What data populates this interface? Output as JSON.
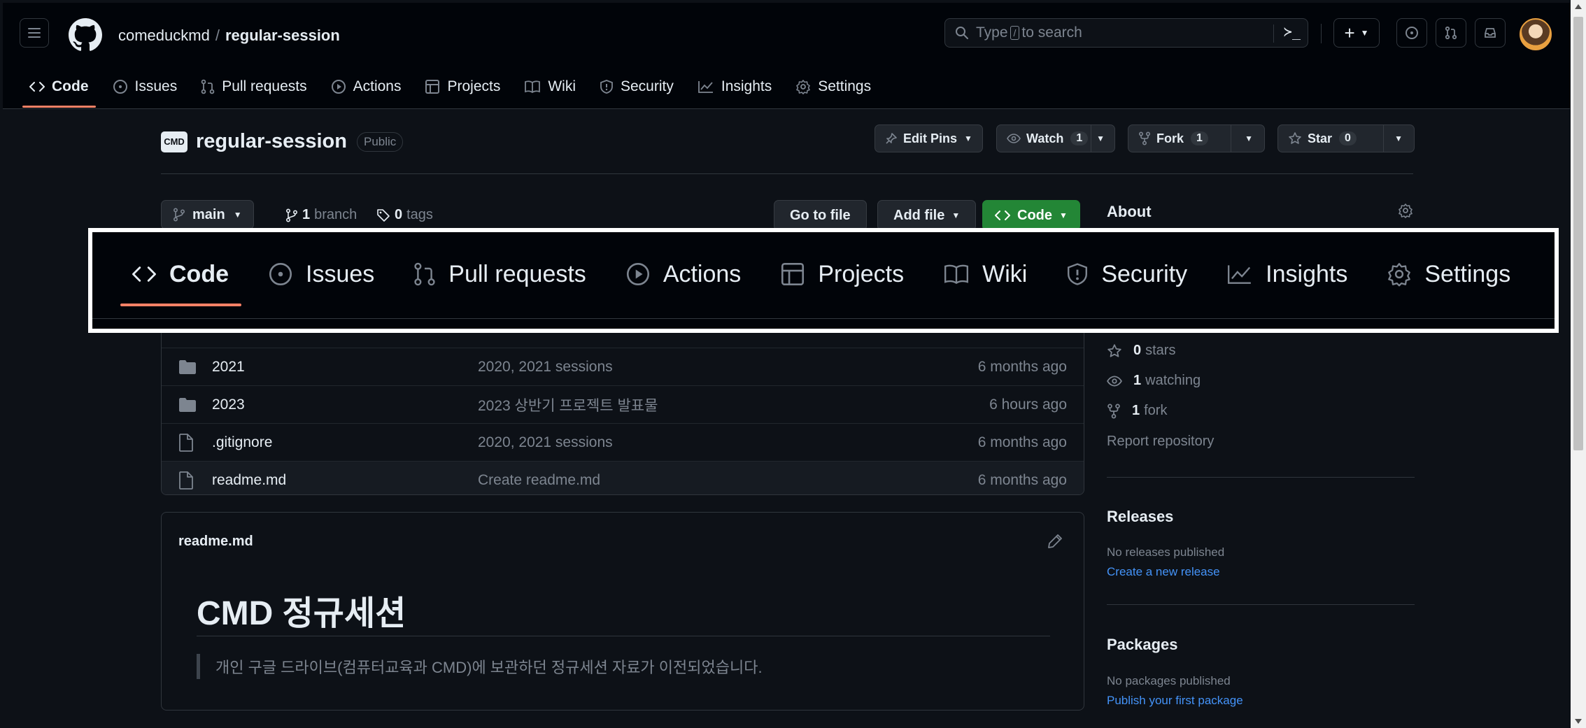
{
  "header": {
    "owner": "comeduckmd",
    "separator": "/",
    "repo": "regular-session",
    "search_prefix": "Type",
    "search_key": "/",
    "search_suffix": "to search",
    "command_glyph": "≻_",
    "new_label": "+"
  },
  "nav": {
    "items": [
      {
        "label": "Code",
        "icon": "code-icon"
      },
      {
        "label": "Issues",
        "icon": "issue-icon"
      },
      {
        "label": "Pull requests",
        "icon": "pull-request-icon"
      },
      {
        "label": "Actions",
        "icon": "play-icon"
      },
      {
        "label": "Projects",
        "icon": "table-icon"
      },
      {
        "label": "Wiki",
        "icon": "book-icon"
      },
      {
        "label": "Security",
        "icon": "shield-icon"
      },
      {
        "label": "Insights",
        "icon": "graph-icon"
      },
      {
        "label": "Settings",
        "icon": "gear-icon"
      }
    ]
  },
  "repo": {
    "logo_text": "CMD",
    "title": "regular-session",
    "visibility": "Public",
    "edit_pins": "Edit Pins",
    "watch": "Watch",
    "watch_count": "1",
    "fork": "Fork",
    "fork_count": "1",
    "star": "Star",
    "star_count": "0"
  },
  "branch": {
    "current": "main",
    "branch_count": "1",
    "branch_label": "branch",
    "tag_count": "0",
    "tag_label": "tags",
    "go_to_file": "Go to file",
    "add_file": "Add file",
    "code": "Code"
  },
  "files": [
    {
      "name": "2021",
      "type": "folder",
      "commit": "2020, 2021 sessions",
      "age": "6 months ago"
    },
    {
      "name": "2023",
      "type": "folder",
      "commit": "2023 상반기 프로젝트 발표물",
      "age": "6 hours ago"
    },
    {
      "name": ".gitignore",
      "type": "file",
      "commit": "2020, 2021 sessions",
      "age": "6 months ago"
    },
    {
      "name": "readme.md",
      "type": "file",
      "commit": "Create readme.md",
      "age": "6 months ago"
    }
  ],
  "readme": {
    "filename": "readme.md",
    "heading": "CMD 정규세션",
    "quote": "개인 구글 드라이브(컴퓨터교육과 CMD)에 보관하던 정규세션 자료가 이전되었습니다."
  },
  "sidebar": {
    "about": "About",
    "stars": "0",
    "stars_label": "stars",
    "watching": "1",
    "watching_label": "watching",
    "forks": "1",
    "forks_label": "fork",
    "report": "Report repository",
    "releases_title": "Releases",
    "releases_empty": "No releases published",
    "releases_link": "Create a new release",
    "packages_title": "Packages",
    "packages_empty": "No packages published",
    "packages_link": "Publish your first package"
  },
  "colors": {
    "accent_underline": "#f78166",
    "primary_button": "#238636",
    "link": "#4493f8",
    "background": "#0d1117"
  }
}
